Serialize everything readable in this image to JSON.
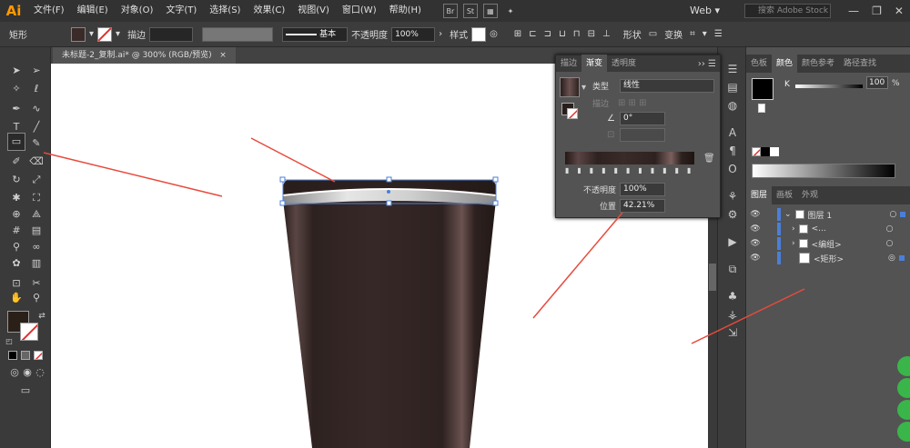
{
  "app": {
    "logo": "Ai"
  },
  "menu": [
    "文件(F)",
    "编辑(E)",
    "对象(O)",
    "文字(T)",
    "选择(S)",
    "效果(C)",
    "视图(V)",
    "窗口(W)",
    "帮助(H)"
  ],
  "bridge": {
    "br": "Br",
    "st": "St"
  },
  "workspace": "Web",
  "search": {
    "placeholder": "搜索 Adobe Stock"
  },
  "control": {
    "object_label": "矩形",
    "stroke_label": "描边",
    "stroke_style": "基本",
    "opacity_label": "不透明度",
    "opacity_value": "100%",
    "style_label": "样式",
    "shape_label": "形状",
    "transform_label": "变换"
  },
  "document": {
    "tab": "未标题-2_复制.ai* @ 300% (RGB/预览)",
    "close": "×"
  },
  "gradient_panel": {
    "tabs": [
      "描边",
      "渐变",
      "透明度"
    ],
    "active_tab": "渐变",
    "type_label": "类型",
    "type_value": "线性",
    "stroke_label": "描边",
    "angle_value": "0°",
    "opacity_label": "不透明度",
    "opacity_value": "100%",
    "location_label": "位置",
    "location_value": "42.21%"
  },
  "color_panel": {
    "tabs": [
      "色板",
      "颜色",
      "颜色参考",
      "路径查找"
    ],
    "active_tab": "颜色",
    "channel": "K",
    "value": "100",
    "unit": "%"
  },
  "layers_panel": {
    "tabs": [
      "图层",
      "画板",
      "外观"
    ],
    "active_tab": "图层",
    "rows": [
      {
        "name": "图层 1",
        "indent": 0
      },
      {
        "name": "<...",
        "indent": 1
      },
      {
        "name": "<编组>",
        "indent": 1
      },
      {
        "name": "<矩形>",
        "indent": 1
      }
    ]
  },
  "colors": {
    "accent": "#e84a3c",
    "cup": "#3a2a28",
    "selection": "#4a7fd9"
  }
}
